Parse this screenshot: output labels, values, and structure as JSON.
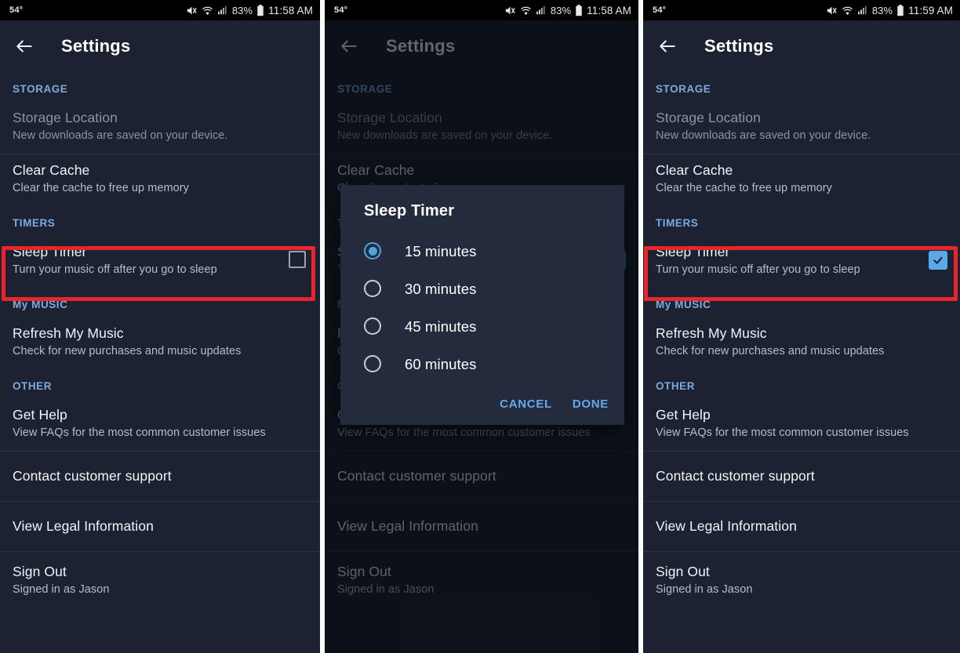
{
  "statusbar": {
    "temperature": "54°",
    "battery_percent": "83%",
    "time_left": "11:58 AM",
    "time_mid": "11:58 AM",
    "time_right": "11:59 AM",
    "icons": [
      "mute-icon",
      "wifi-icon",
      "signal-icon",
      "battery-icon"
    ]
  },
  "appbar": {
    "back_icon": "back-arrow-icon",
    "title": "Settings"
  },
  "sections": {
    "storage": {
      "header": "STORAGE",
      "items": [
        {
          "title": "Storage Location",
          "subtitle": "New downloads are saved on your device.",
          "disabled": true
        },
        {
          "title": "Clear Cache",
          "subtitle": "Clear the cache to free up memory",
          "disabled": false
        }
      ]
    },
    "timers": {
      "header": "TIMERS",
      "items": [
        {
          "title": "Sleep Timer",
          "subtitle": "Turn your music off after you go to sleep",
          "checkbox_state_panel1": "unchecked",
          "checkbox_state_panel3": "checked"
        }
      ]
    },
    "my_music": {
      "header": "My MUSIC",
      "items": [
        {
          "title": "Refresh My Music",
          "subtitle": "Check for new purchases and music updates"
        }
      ]
    },
    "other": {
      "header": "OTHER",
      "items": [
        {
          "title": "Get Help",
          "subtitle": "View FAQs for the most common customer issues"
        }
      ]
    },
    "footer": {
      "items": [
        {
          "title": "Contact customer support",
          "subtitle": ""
        },
        {
          "title": "View Legal Information",
          "subtitle": ""
        },
        {
          "title": "Sign Out",
          "subtitle": "Signed in as Jason"
        }
      ]
    }
  },
  "dialog": {
    "title": "Sleep Timer",
    "options": [
      {
        "label": "15 minutes",
        "selected": true
      },
      {
        "label": "30 minutes",
        "selected": false
      },
      {
        "label": "45 minutes",
        "selected": false
      },
      {
        "label": "60 minutes",
        "selected": false
      }
    ],
    "cancel_label": "CANCEL",
    "done_label": "DONE"
  },
  "colors": {
    "background": "#1c2231",
    "section_header": "#7eaade",
    "accent": "#5aa9e8",
    "highlight_border": "#e8252b",
    "dialog_background": "#232b3d",
    "status_bar": "#000000"
  }
}
